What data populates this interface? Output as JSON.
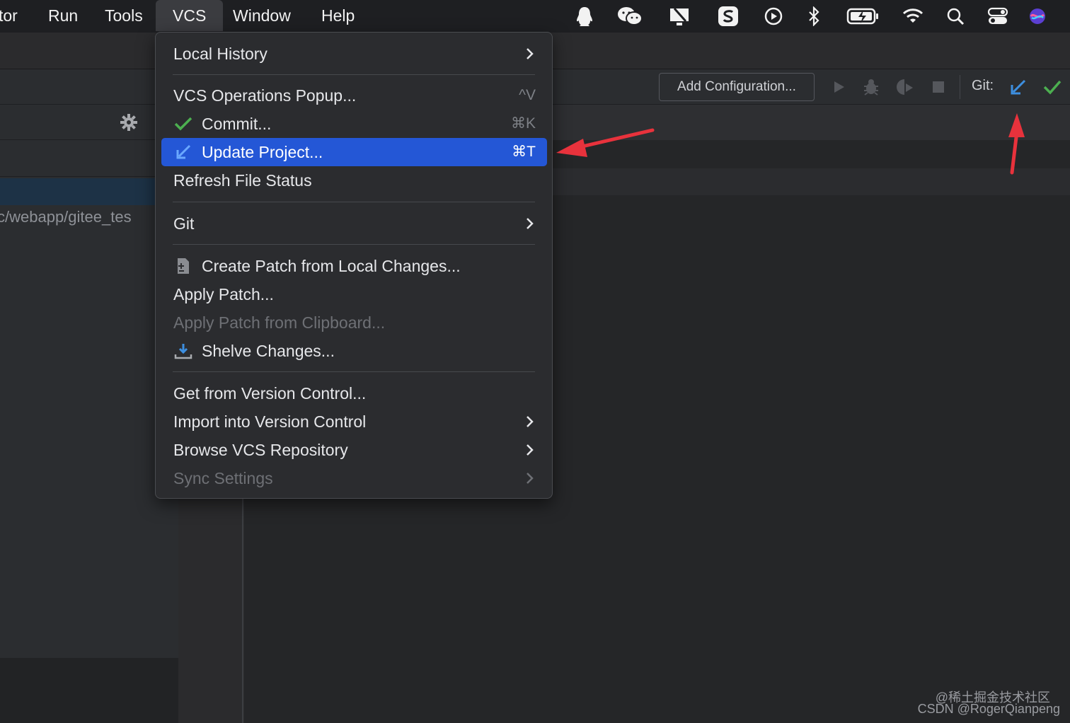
{
  "menubar": {
    "items": [
      "tor",
      "Run",
      "Tools",
      "VCS",
      "Window",
      "Help"
    ],
    "active": "VCS",
    "status_icons": [
      "qq-icon",
      "wechat-icon",
      "screen-capture-icon",
      "sogou-input-icon",
      "play-circle-icon",
      "bluetooth-icon",
      "battery-charging-icon",
      "wifi-icon",
      "search-icon",
      "control-center-icon",
      "siri-icon"
    ]
  },
  "toolbar": {
    "add_configuration": "Add Configuration...",
    "git_label": "Git:"
  },
  "project_panel": {
    "path": "c/webapp/gitee_tes"
  },
  "vcs_menu": {
    "local_history": "Local History",
    "vcs_operations_popup": "VCS Operations Popup...",
    "vcs_operations_shortcut": "^V",
    "commit": "Commit...",
    "commit_shortcut": "⌘K",
    "update_project": "Update Project...",
    "update_project_shortcut": "⌘T",
    "refresh_file_status": "Refresh File Status",
    "git": "Git",
    "create_patch": "Create Patch from Local Changes...",
    "apply_patch": "Apply Patch...",
    "apply_patch_clipboard": "Apply Patch from Clipboard...",
    "shelve_changes": "Shelve Changes...",
    "get_from_vcs": "Get from Version Control...",
    "import_into_vcs": "Import into Version Control",
    "browse_vcs_repo": "Browse VCS Repository",
    "sync_settings": "Sync Settings"
  },
  "watermark": {
    "line1": "@稀土掘金技术社区",
    "line2": "CSDN @RogerQianpeng"
  },
  "colors": {
    "selection": "#2457d6",
    "annotation_arrow": "#e8323c",
    "commit_check": "#4caf50",
    "update_arrow": "#3d8fe0"
  }
}
